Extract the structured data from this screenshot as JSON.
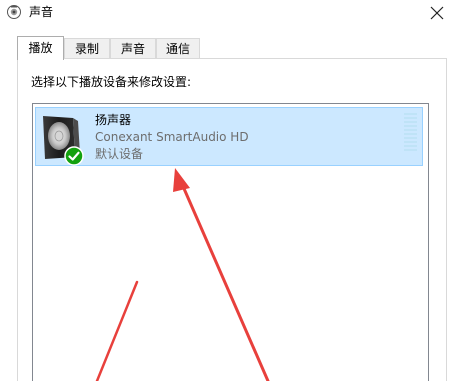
{
  "window": {
    "title": "声音",
    "icon": "speaker-settings-icon"
  },
  "tabs": [
    {
      "label": "播放",
      "active": true
    },
    {
      "label": "录制",
      "active": false
    },
    {
      "label": "声音",
      "active": false
    },
    {
      "label": "通信",
      "active": false
    }
  ],
  "playback": {
    "instruction": "选择以下播放设备来修改设置:",
    "devices": [
      {
        "name": "扬声器",
        "driver": "Conexant SmartAudio HD",
        "status": "默认设备",
        "icon": "speaker-icon",
        "badge": "default-check-icon",
        "selected": true
      }
    ]
  },
  "colors": {
    "selection_bg": "#cce8ff",
    "selection_border": "#99d1ff",
    "check_green": "#13a10e",
    "annotation_arrow": "#e8403c"
  }
}
